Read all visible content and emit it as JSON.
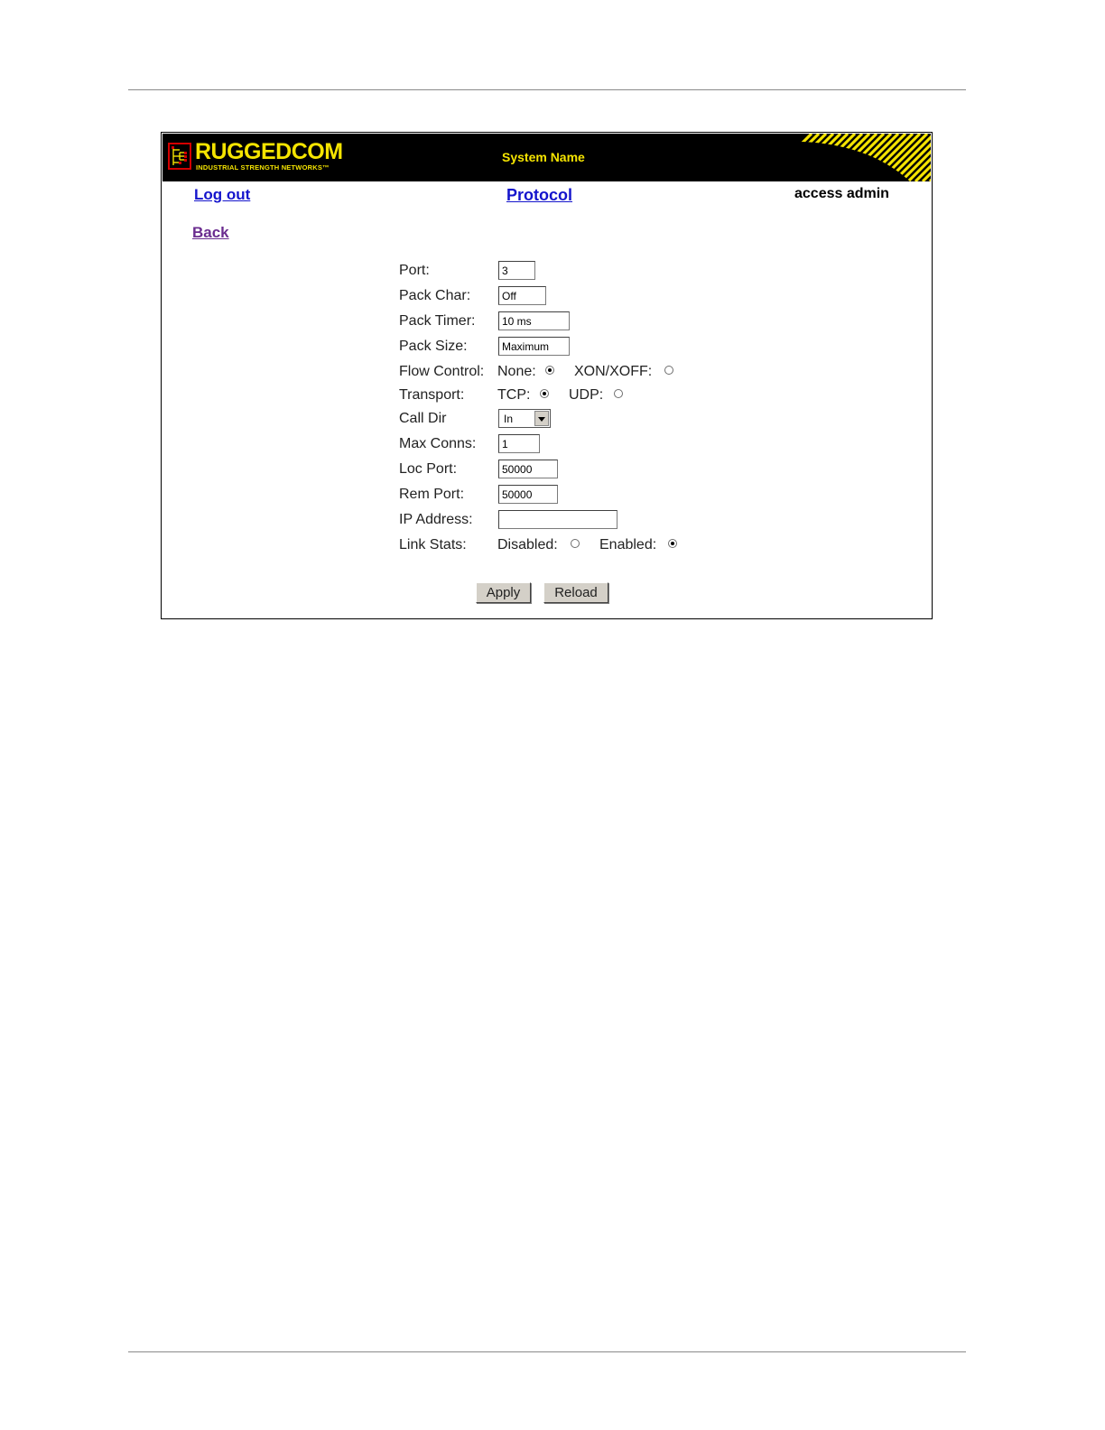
{
  "header": {
    "logo_word": "RUGGEDCOM",
    "logo_tagline": "INDUSTRIAL STRENGTH NETWORKS™",
    "system_name": "System Name"
  },
  "nav": {
    "logout": "Log out",
    "page_title": "Protocol",
    "access": "access admin",
    "back": "Back"
  },
  "form": {
    "port": {
      "label": "Port:",
      "value": "3"
    },
    "pack_char": {
      "label": "Pack Char:",
      "value": "Off"
    },
    "pack_timer": {
      "label": "Pack Timer:",
      "value": "10 ms"
    },
    "pack_size": {
      "label": "Pack Size:",
      "value": "Maximum"
    },
    "flow_control": {
      "label": "Flow Control:",
      "options": [
        {
          "label": "None:",
          "selected": true
        },
        {
          "label": "XON/XOFF:",
          "selected": false
        }
      ]
    },
    "transport": {
      "label": "Transport:",
      "options": [
        {
          "label": "TCP:",
          "selected": true
        },
        {
          "label": "UDP:",
          "selected": false
        }
      ]
    },
    "call_dir": {
      "label": "Call Dir",
      "value": "In"
    },
    "max_conns": {
      "label": "Max Conns:",
      "value": "1"
    },
    "loc_port": {
      "label": "Loc Port:",
      "value": "50000"
    },
    "rem_port": {
      "label": "Rem Port:",
      "value": "50000"
    },
    "ip_address": {
      "label": "IP Address:",
      "value": ""
    },
    "link_stats": {
      "label": "Link Stats:",
      "options": [
        {
          "label": "Disabled:",
          "selected": false
        },
        {
          "label": "Enabled:",
          "selected": true
        }
      ]
    }
  },
  "buttons": {
    "apply": "Apply",
    "reload": "Reload"
  },
  "colors": {
    "banner": "#000000",
    "brand_yellow": "#f5e400",
    "logo_red": "#d40000",
    "link_blue": "#1414cc",
    "visited_purple": "#6a2c8f",
    "button_face": "#d4d0c8"
  }
}
